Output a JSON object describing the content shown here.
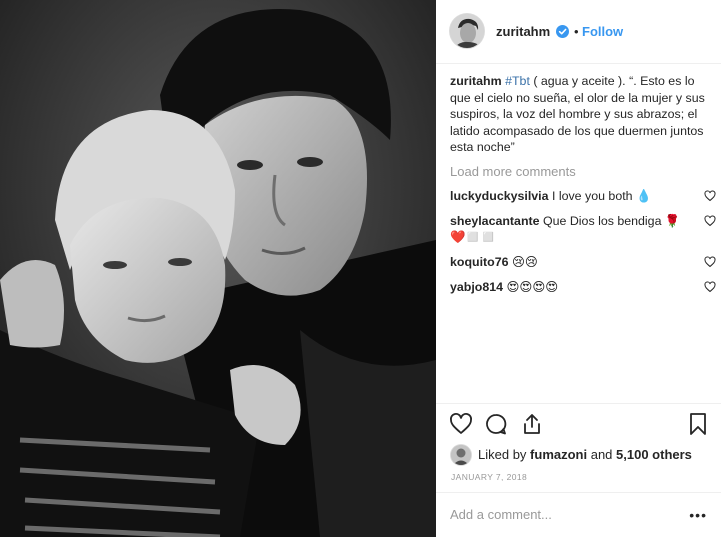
{
  "post": {
    "username": "zuritahm",
    "follow_label": "Follow",
    "dot": "•"
  },
  "caption": {
    "username": "zuritahm",
    "hashtag": "#Tbt",
    "text": " ( agua y aceite ). “. Esto es lo que el cielo no sueña, el olor de la mujer y sus suspiros, la voz del hombre y sus abrazos; el latido acompasado de los que duermen juntos esta noche”"
  },
  "load_more": "Load more comments",
  "comments": [
    {
      "username": "luckyduckysilvia",
      "text": "I love you both 💧"
    },
    {
      "username": "sheylacantante",
      "text": "Que Dios los bendiga 🌹❤️◻️◻️"
    },
    {
      "username": "koquito76",
      "text": "😢😢"
    },
    {
      "username": "yabjo814",
      "text": "😍😍😍😍"
    }
  ],
  "likes": {
    "prefix": "Liked by ",
    "user": "fumazoni",
    "suffix": " and ",
    "count": "5,100 others"
  },
  "date": "JANUARY 7, 2018",
  "add_comment_placeholder": "Add a comment...",
  "more_label": "•••",
  "icons": {
    "verified": "verified-badge-icon",
    "like": "heart-icon",
    "comment": "comment-icon",
    "share": "share-icon",
    "save": "bookmark-icon"
  },
  "colors": {
    "accent": "#3897f0",
    "hashtag": "#3a71a8",
    "muted": "#999999",
    "text": "#262626"
  }
}
